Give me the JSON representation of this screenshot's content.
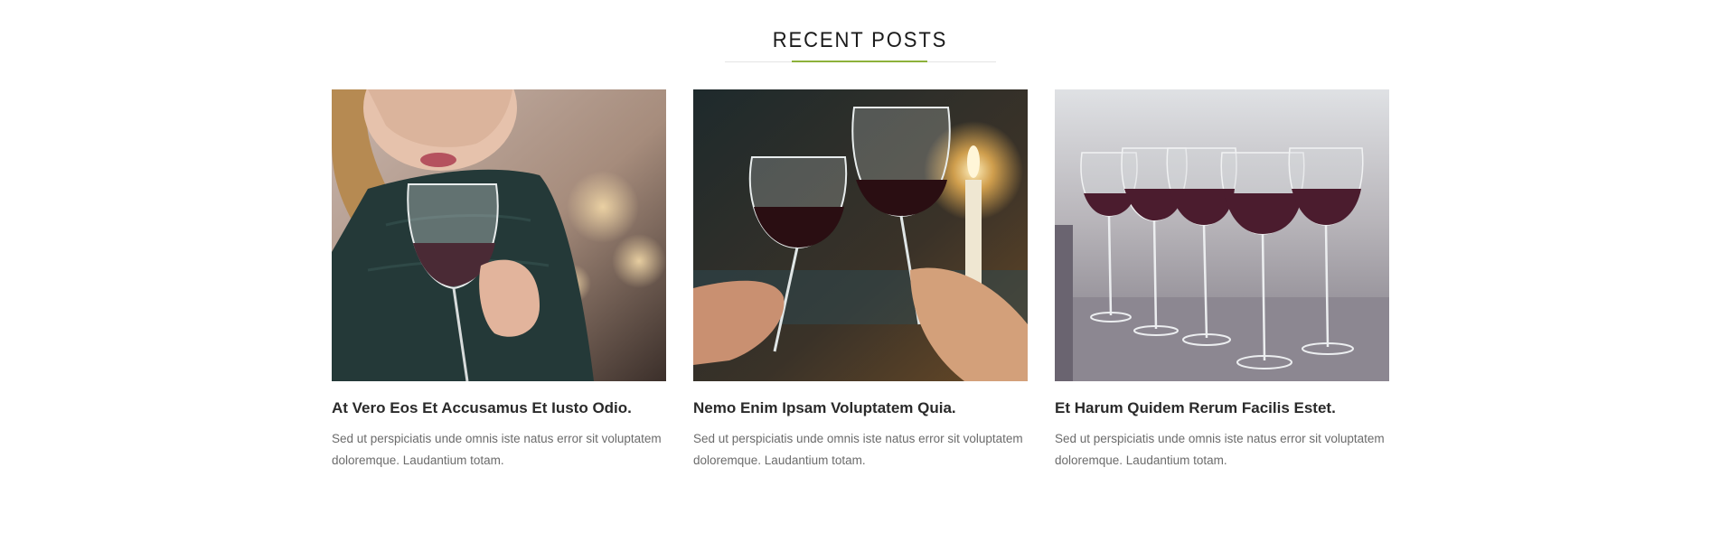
{
  "section": {
    "title": "RECENT POSTS",
    "accent_color": "#8db13a"
  },
  "posts": [
    {
      "title": "At Vero Eos Et Accusamus Et Iusto Odio.",
      "excerpt": "Sed ut perspiciatis unde omnis iste natus error sit voluptatem doloremque. Laudantium totam.",
      "image": "woman-tasting-red-wine-photo"
    },
    {
      "title": "Nemo Enim Ipsam Voluptatem Quia.",
      "excerpt": "Sed ut perspiciatis unde omnis iste natus error sit voluptatem doloremque. Laudantium totam.",
      "image": "two-glasses-toast-candlelight-photo"
    },
    {
      "title": "Et Harum Quidem Rerum Facilis Estet.",
      "excerpt": "Sed ut perspiciatis unde omnis iste natus error sit voluptatem doloremque. Laudantium totam.",
      "image": "rows-of-wine-glasses-photo"
    }
  ]
}
